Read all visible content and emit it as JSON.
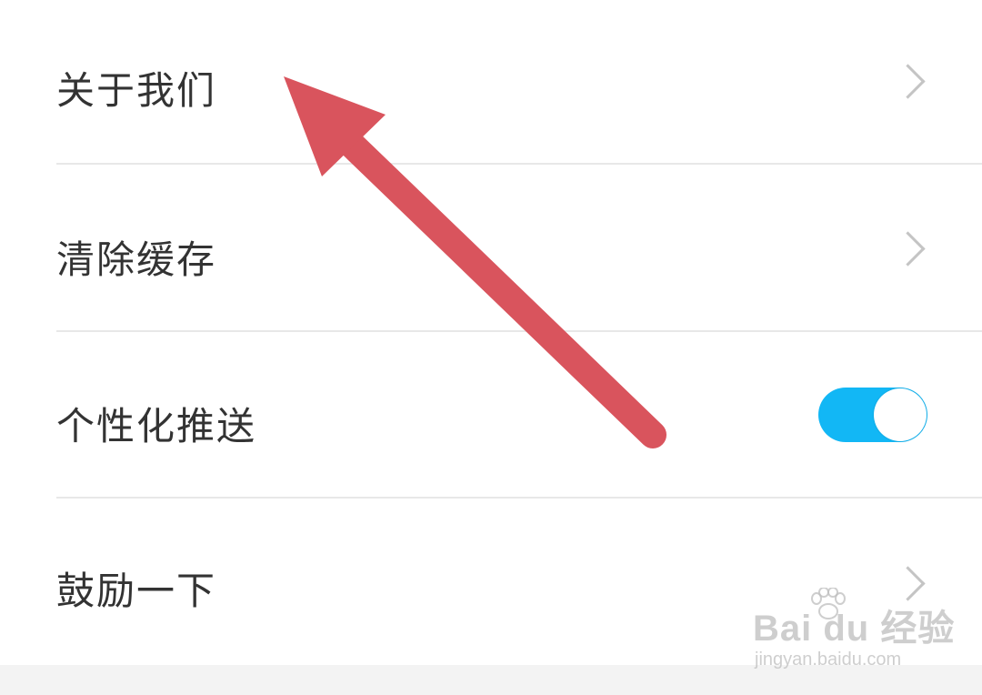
{
  "settings": {
    "items": [
      {
        "label": "关于我们",
        "control": "chevron"
      },
      {
        "label": "清除缓存",
        "control": "chevron"
      },
      {
        "label": "个性化推送",
        "control": "toggle",
        "enabled": true
      },
      {
        "label": "鼓励一下",
        "control": "chevron"
      }
    ]
  },
  "icons": {
    "chevron": "chevron-right-icon",
    "annotation": "red-arrow-annotation"
  },
  "colors": {
    "toggle_on": "#12b7f5",
    "arrow": "#d9545d",
    "text": "#333333",
    "chevron": "#c4c4c4"
  },
  "watermark": {
    "brand": "Bai du 经验",
    "url": "jingyan.baidu.com"
  }
}
